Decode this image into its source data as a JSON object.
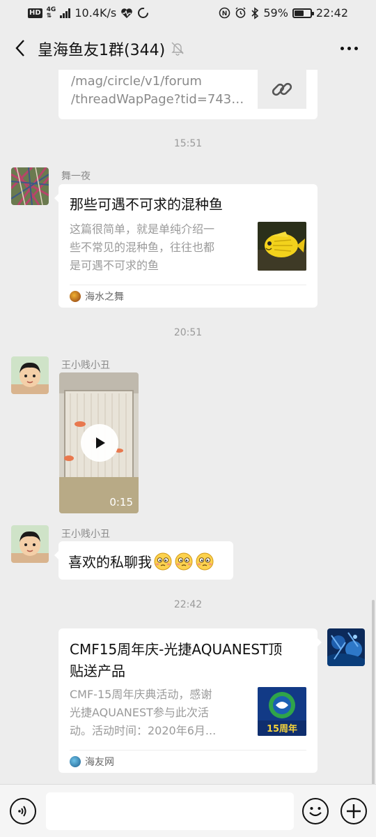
{
  "status_bar": {
    "hd": "HD",
    "network": "4G",
    "speed": "10.4K/s",
    "battery": "59%",
    "battery_level": 0.59,
    "time": "22:42"
  },
  "header": {
    "title": "皇海鱼友1群(344)"
  },
  "messages": {
    "link_card": {
      "lines": [
        "/mag/circle/v1/forum",
        "/threadWapPage?tid=7438..."
      ]
    },
    "time_1": "15:51",
    "article_1": {
      "sender": "舞一夜",
      "title": "那些可遇不可求的混种鱼",
      "desc_lines": [
        "这篇很简单，就是单纯介绍一",
        "些不常见的混种鱼，往往也都",
        "是可遇不可求的鱼"
      ],
      "source": "海水之舞"
    },
    "time_2": "20:51",
    "video_msg": {
      "sender": "王小贱小丑",
      "duration": "0:15"
    },
    "text_msg": {
      "sender": "王小贱小丑",
      "text": "喜欢的私聊我"
    },
    "time_3": "22:42",
    "article_2": {
      "title_lines": [
        "CMF15周年庆-光捷AQUANEST顶",
        "贴送产品"
      ],
      "desc_lines": [
        "CMF-15周年庆典活动，感谢",
        "光捷AQUANEST参与此次活",
        "动。活动时间：2020年6月..."
      ],
      "source": "海友网",
      "thumb_text": "15周年"
    }
  },
  "input_bar": {
    "placeholder": ""
  },
  "colors": {
    "background": "#ededed",
    "bubble": "#ffffff",
    "secondary_text": "#9a9a9a"
  }
}
